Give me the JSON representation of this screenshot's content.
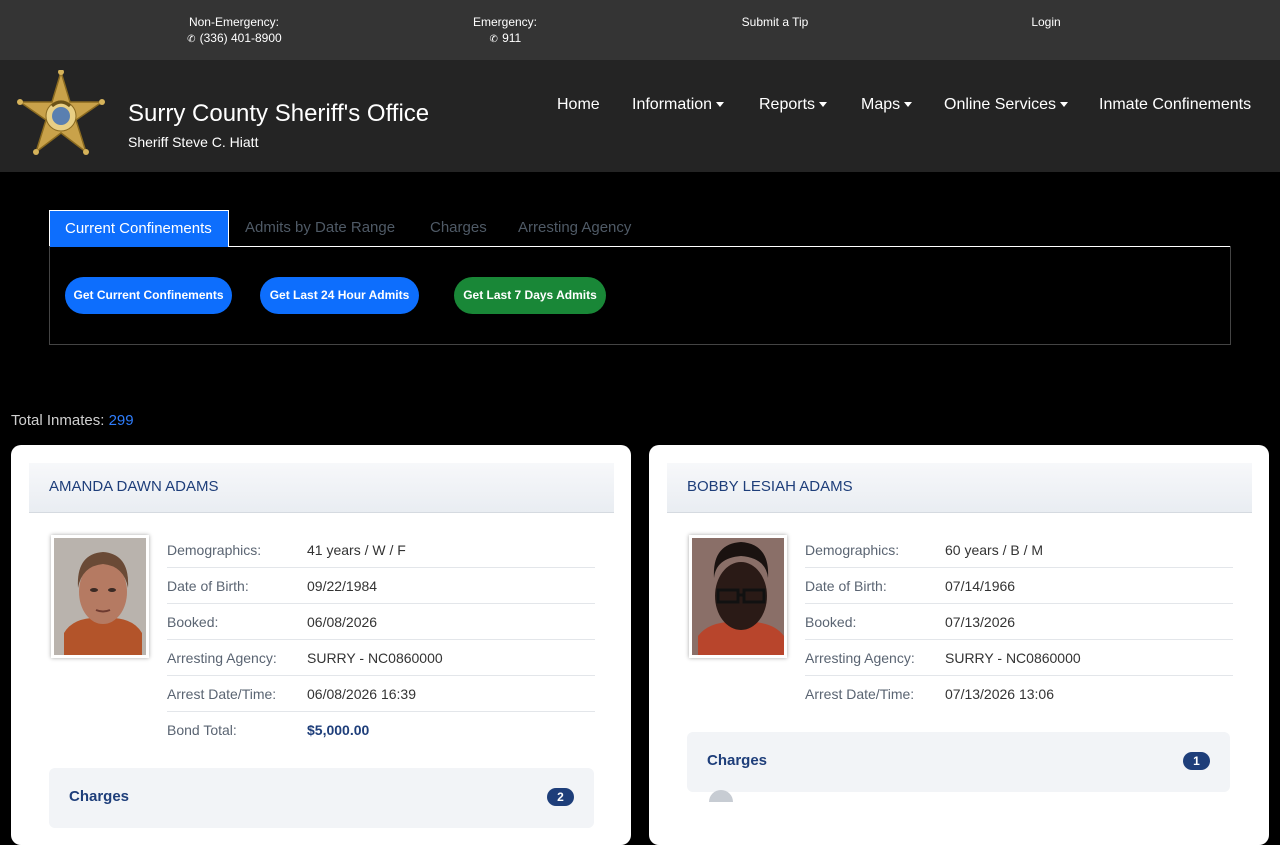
{
  "topbar": {
    "non_emergency_label": "Non-Emergency:",
    "non_emergency_phone": "(336) 401-8900",
    "emergency_label": "Emergency:",
    "emergency_phone": "911",
    "tip_label": "Submit a Tip",
    "login_label": "Login"
  },
  "header": {
    "title": "Surry County Sheriff's Office",
    "subtitle": "Sheriff Steve C. Hiatt",
    "nav": [
      {
        "label": "Home",
        "dropdown": false
      },
      {
        "label": "Information",
        "dropdown": true
      },
      {
        "label": "Reports",
        "dropdown": true
      },
      {
        "label": "Maps",
        "dropdown": true
      },
      {
        "label": "Online Services",
        "dropdown": true
      },
      {
        "label": "Inmate Confinements",
        "dropdown": false
      }
    ]
  },
  "tabs": [
    {
      "label": "Current Confinements",
      "active": true
    },
    {
      "label": "Admits by Date Range",
      "active": false
    },
    {
      "label": "Charges",
      "active": false
    },
    {
      "label": "Arresting Agency",
      "active": false
    }
  ],
  "buttons": {
    "current": "Get Current Confinements",
    "last24": "Get Last 24 Hour Admits",
    "last7": "Get Last 7 Days Admits"
  },
  "total": {
    "label": "Total Inmates:",
    "value": "299"
  },
  "inmates": [
    {
      "name": "AMANDA DAWN ADAMS",
      "rows": [
        {
          "k": "Demographics:",
          "v": "41 years / W / F"
        },
        {
          "k": "Date of Birth:",
          "v": "09/22/1984"
        },
        {
          "k": "Booked:",
          "v": "06/08/2026"
        },
        {
          "k": "Arresting Agency:",
          "v": "SURRY - NC0860000"
        },
        {
          "k": "Arrest Date/Time:",
          "v": "06/08/2026 16:39"
        },
        {
          "k": "Bond Total:",
          "v": "$5,000.00"
        }
      ],
      "charges_label": "Charges",
      "charges_count": "2"
    },
    {
      "name": "BOBBY LESIAH ADAMS",
      "rows": [
        {
          "k": "Demographics:",
          "v": "60 years / B / M"
        },
        {
          "k": "Date of Birth:",
          "v": "07/14/1966"
        },
        {
          "k": "Booked:",
          "v": "07/13/2026"
        },
        {
          "k": "Arresting Agency:",
          "v": "SURRY - NC0860000"
        },
        {
          "k": "Arrest Date/Time:",
          "v": "07/13/2026 13:06"
        }
      ],
      "charges_label": "Charges",
      "charges_count": "1"
    }
  ],
  "colors": {
    "accent": "#0d6efd",
    "green": "#198737",
    "navy": "#1e3e7a"
  }
}
